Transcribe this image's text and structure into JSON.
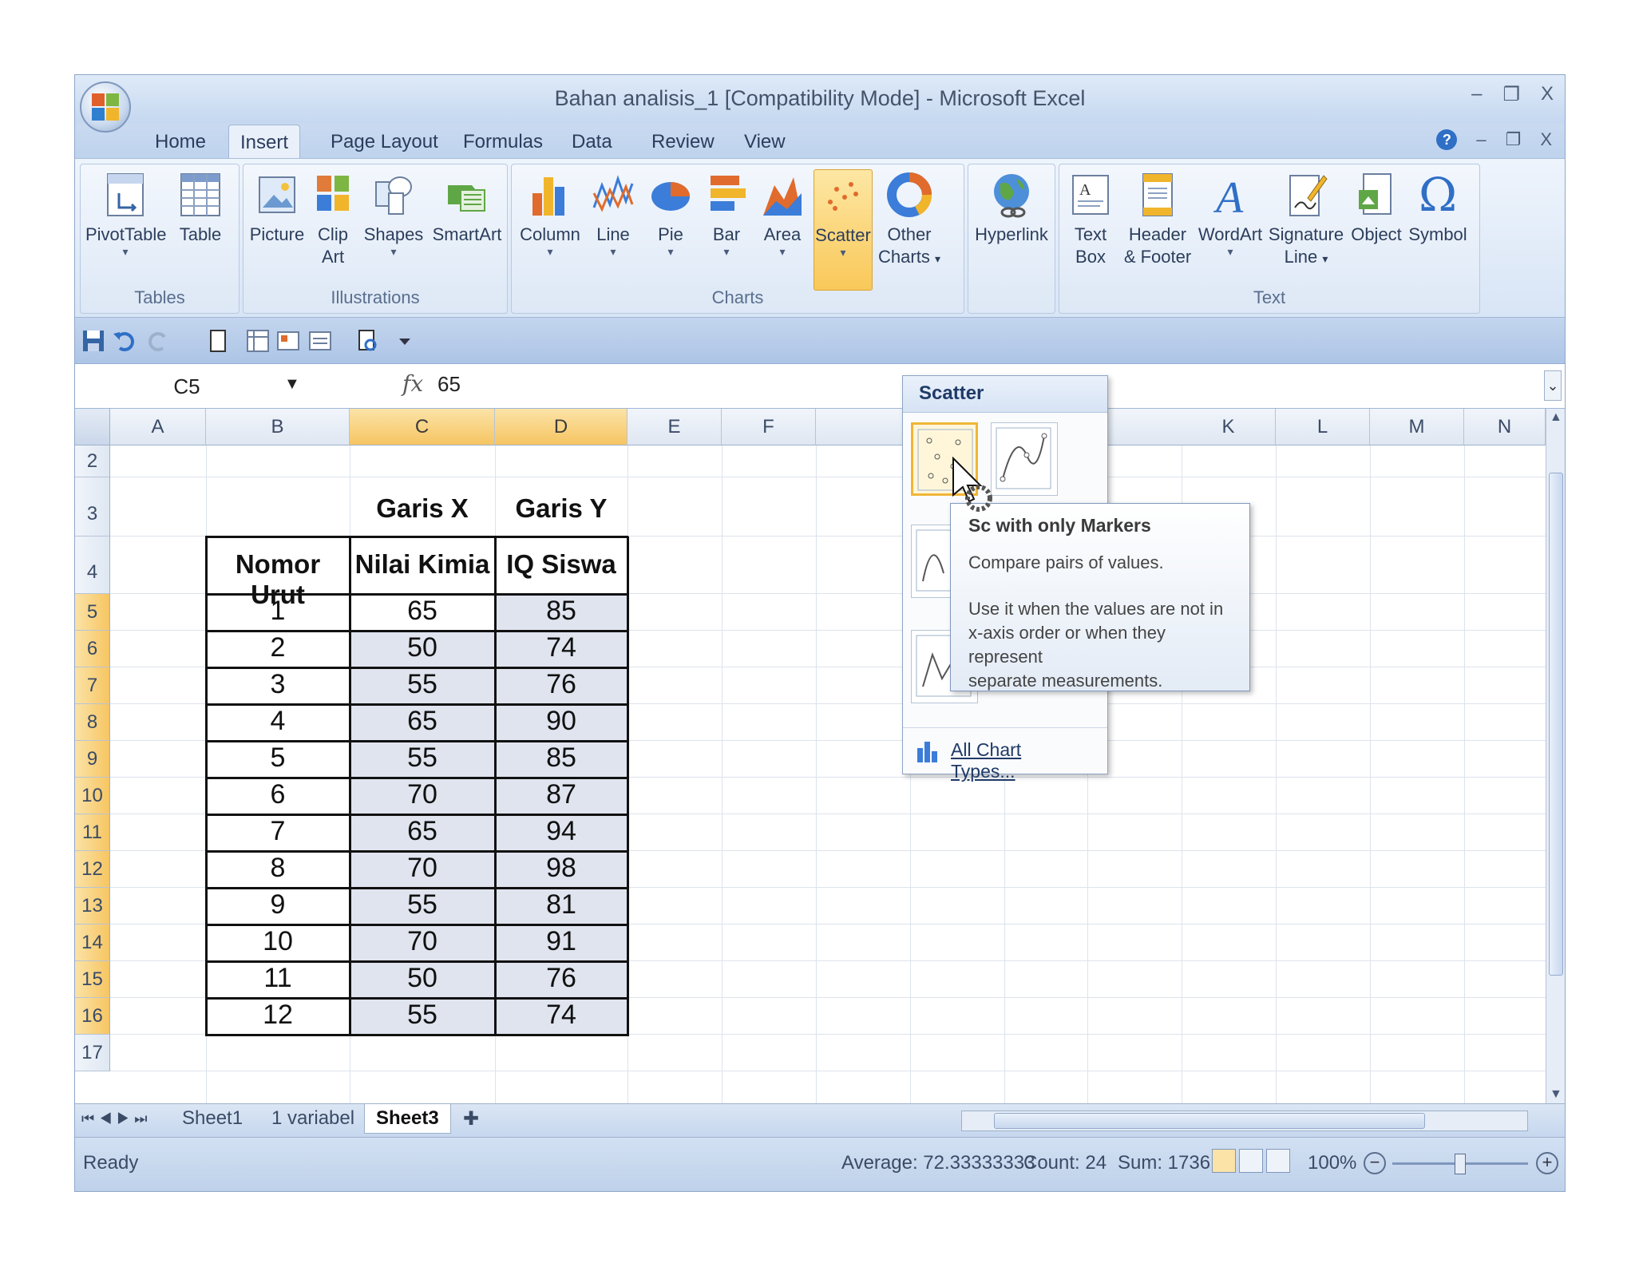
{
  "window": {
    "title": "Bahan analisis_1  [Compatibility Mode] - Microsoft Excel",
    "controls": [
      "–",
      "❐",
      "X"
    ]
  },
  "tabs": [
    "Home",
    "Insert",
    "Page Layout",
    "Formulas",
    "Data",
    "Review",
    "View"
  ],
  "active_tab": "Insert",
  "ribbon": {
    "groups": {
      "tables": "Tables",
      "illustrations": "Illustrations",
      "charts": "Charts",
      "text": "Text"
    },
    "buttons": {
      "pivottable": "PivotTable",
      "table": "Table",
      "picture": "Picture",
      "clipart_1": "Clip",
      "clipart_2": "Art",
      "shapes": "Shapes",
      "smartart": "SmartArt",
      "column": "Column",
      "line": "Line",
      "pie": "Pie",
      "bar": "Bar",
      "area": "Area",
      "scatter": "Scatter",
      "other_1": "Other",
      "other_2": "Charts",
      "hyperlink": "Hyperlink",
      "textbox_1": "Text",
      "textbox_2": "Box",
      "header_1": "Header",
      "header_2": "& Footer",
      "wordart": "WordArt",
      "signature_1": "Signature",
      "signature_2": "Line",
      "object": "Object",
      "symbol": "Symbol"
    }
  },
  "formula_bar": {
    "name_box": "C5",
    "fx": "fx",
    "value": "65"
  },
  "columns": [
    "A",
    "B",
    "C",
    "D",
    "E",
    "F",
    "K",
    "L",
    "M",
    "N"
  ],
  "rows": [
    "2",
    "3",
    "4",
    "5",
    "6",
    "7",
    "8",
    "9",
    "10",
    "11",
    "12",
    "13",
    "14",
    "15",
    "16",
    "17"
  ],
  "table": {
    "garis_x": "Garis X",
    "garis_y": "Garis Y",
    "headers": [
      "Nomor Urut",
      "Nilai Kimia",
      "IQ Siswa"
    ],
    "rows": [
      [
        "1",
        "65",
        "85"
      ],
      [
        "2",
        "50",
        "74"
      ],
      [
        "3",
        "55",
        "76"
      ],
      [
        "4",
        "65",
        "90"
      ],
      [
        "5",
        "55",
        "85"
      ],
      [
        "6",
        "70",
        "87"
      ],
      [
        "7",
        "65",
        "94"
      ],
      [
        "8",
        "70",
        "98"
      ],
      [
        "9",
        "55",
        "81"
      ],
      [
        "10",
        "70",
        "91"
      ],
      [
        "11",
        "50",
        "76"
      ],
      [
        "12",
        "55",
        "74"
      ]
    ]
  },
  "scatter_menu": {
    "header": "Scatter",
    "all_chart_types": "All Chart Types..."
  },
  "tooltip": {
    "title": "Sc    with only Markers",
    "line1": "Compare pairs of values.",
    "line2": "Use it when the values are not in",
    "line3": "x-axis order or when they represent",
    "line4": "separate measurements."
  },
  "sheets": [
    "Sheet1",
    "1 variabel",
    "Sheet3"
  ],
  "active_sheet": "Sheet3",
  "status": {
    "ready": "Ready",
    "average": "Average: 72.33333333",
    "count": "Count: 24",
    "sum": "Sum: 1736",
    "zoom": "100%"
  },
  "colors": {
    "selection_orange": "#f6c562",
    "ribbon_blue": "#dbe6f4",
    "scatter_highlight": "#f9c859"
  }
}
